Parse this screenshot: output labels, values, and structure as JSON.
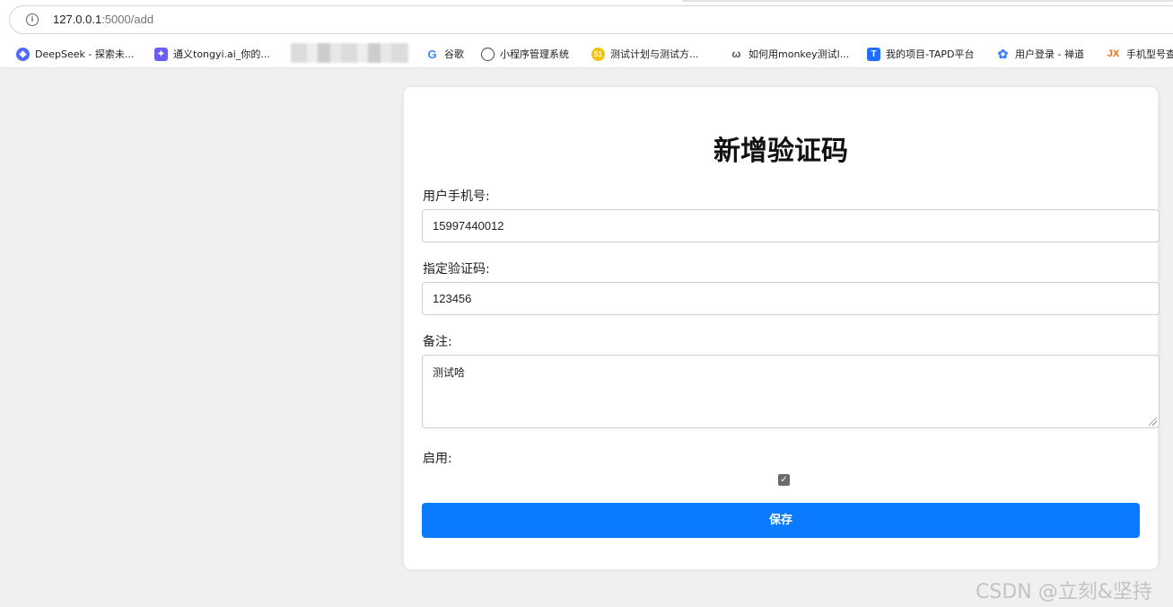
{
  "browser": {
    "url_host": "127.0.0.1",
    "url_path": ":5000/add",
    "info_icon": "info-icon",
    "bookmarks": [
      {
        "label": "DeepSeek - 探索未...",
        "icon": "deepseek-whale-icon",
        "color": "#4d6bfe"
      },
      {
        "label": "通义tongyi.ai_你的...",
        "icon": "tongyi-icon",
        "color": "#6b5cf6"
      },
      {
        "label": "谷歌",
        "icon": "google-g-icon",
        "color": "#4285f4"
      },
      {
        "label": "小程序管理系统",
        "icon": "globe-icon",
        "color": "#444444"
      },
      {
        "label": "测试计划与测试方...",
        "icon": "yellow-circle-icon",
        "color": "#f4c20d"
      },
      {
        "label": "如何用monkey测试l...",
        "icon": "monkey-icon",
        "color": "#555555"
      },
      {
        "label": "我的项目-TAPD平台",
        "icon": "tapd-icon",
        "color": "#1f6fff"
      },
      {
        "label": "用户登录 - 禅道",
        "icon": "zentao-icon",
        "color": "#3b82f6"
      },
      {
        "label": "手机型号查",
        "icon": "jx-icon",
        "color": "#f06a25"
      }
    ]
  },
  "form": {
    "title": "新增验证码",
    "phone_label": "用户手机号:",
    "phone_value": "15997440012",
    "code_label": "指定验证码:",
    "code_value": "123456",
    "note_label": "备注:",
    "note_value": "测试哈",
    "enabled_label": "启用:",
    "enabled_checked": true,
    "save_label": "保存",
    "accent": "#0a7bff"
  },
  "watermark": "CSDN @立刻&坚持"
}
